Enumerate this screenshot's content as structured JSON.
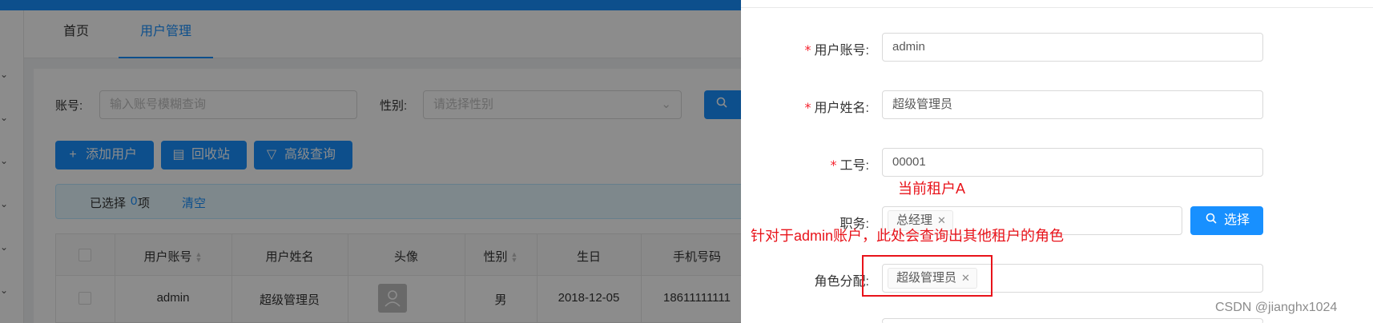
{
  "tabs": [
    {
      "label": "首页"
    },
    {
      "label": "用户管理"
    }
  ],
  "filters": {
    "account_label": "账号:",
    "account_placeholder": "输入账号模糊查询",
    "gender_label": "性别:",
    "gender_placeholder": "请选择性别",
    "search_icon": "search-icon"
  },
  "toolbar": {
    "add_user": "添加用户",
    "recycle_bin": "回收站",
    "advanced_query": "高级查询"
  },
  "selection": {
    "prefix": "已选择",
    "count": "0",
    "suffix": "项",
    "clear": "清空"
  },
  "table": {
    "columns": [
      "用户账号",
      "用户姓名",
      "头像",
      "性别",
      "生日",
      "手机号码"
    ],
    "rows": [
      {
        "account": "admin",
        "name": "超级管理员",
        "gender": "男",
        "birthday": "2018-12-05",
        "phone": "18611111111"
      }
    ]
  },
  "form": {
    "account_label": "用户账号:",
    "account_value": "admin",
    "name_label": "用户姓名:",
    "name_value": "超级管理员",
    "workno_label": "工号:",
    "workno_value": "00001",
    "post_label": "职务:",
    "post_tag": "总经理",
    "select_button": "选择",
    "role_label": "角色分配:",
    "role_tag": "超级管理员"
  },
  "annotations": {
    "tenant_note": "当前租户A",
    "role_note": "针对于admin账户，此处会查询出其他租户的角色",
    "color": "#e8131a"
  },
  "watermark": "CSDN @jianghx1024",
  "colors": {
    "primary": "#1890ff",
    "required": "#f5222d"
  }
}
